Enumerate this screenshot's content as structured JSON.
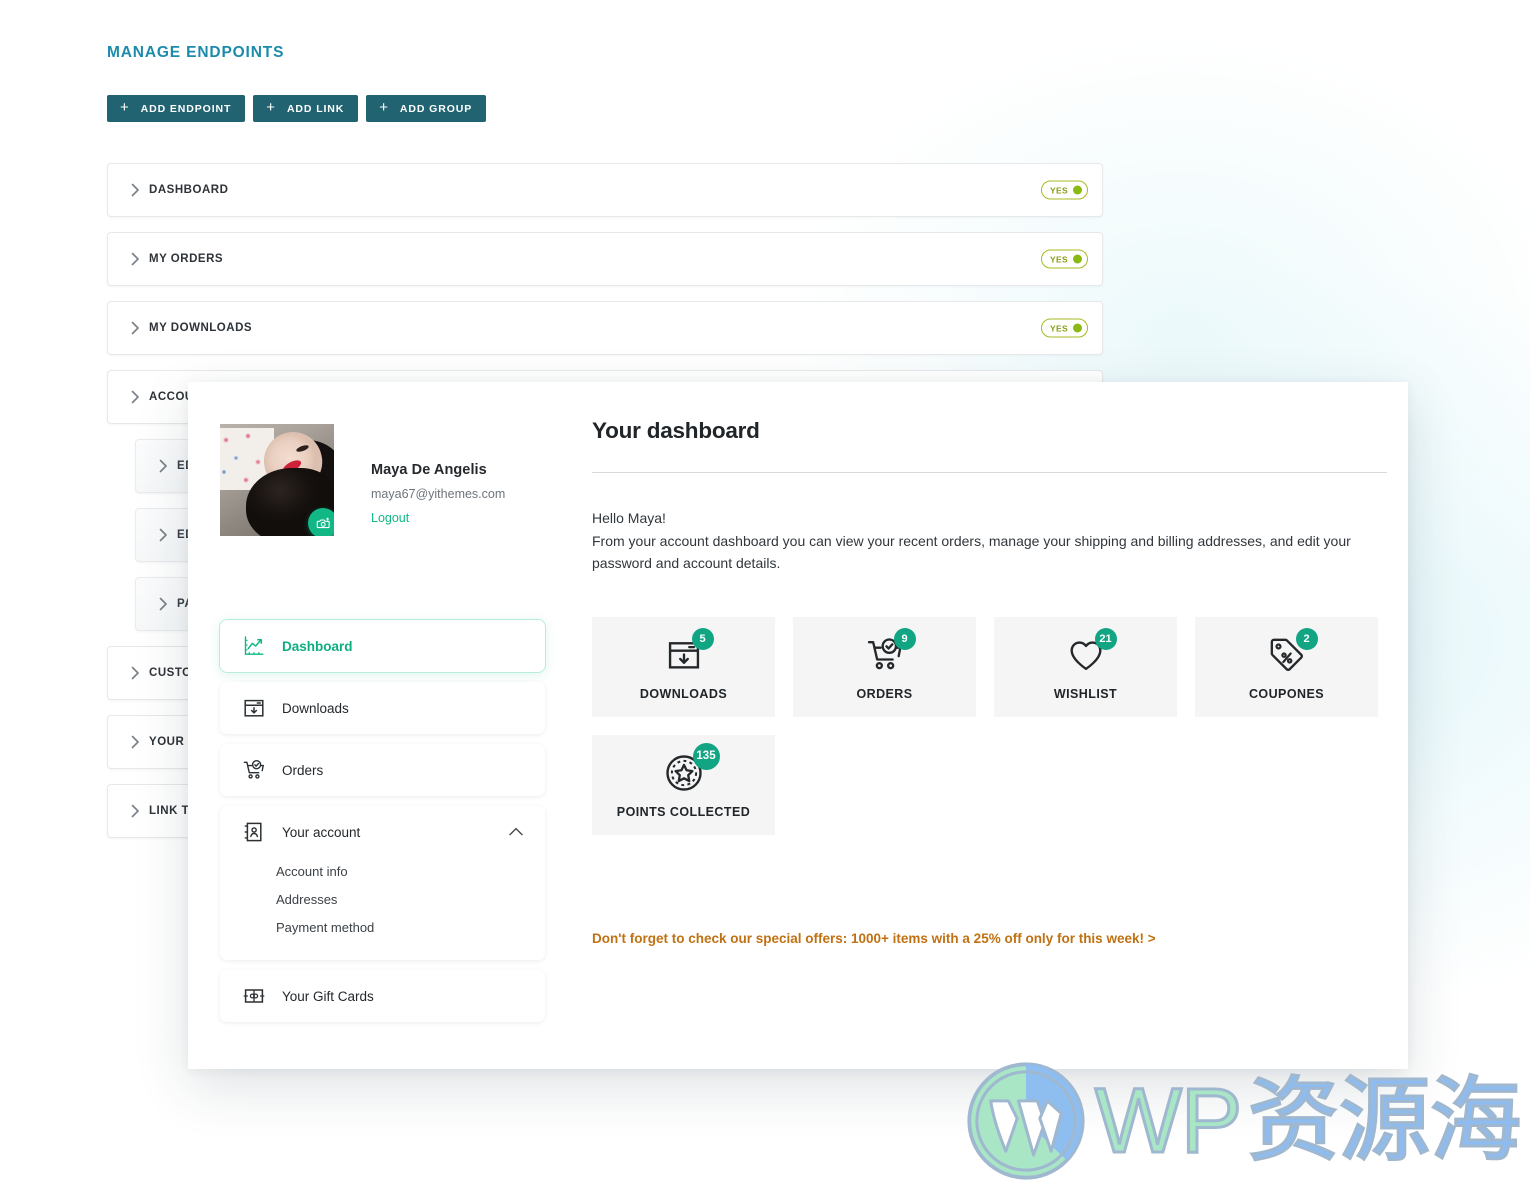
{
  "settings": {
    "title": "MANAGE ENDPOINTS",
    "buttons": [
      {
        "label": "ADD ENDPOINT",
        "icon": "plus-icon"
      },
      {
        "label": "ADD LINK",
        "icon": "plus-icon"
      },
      {
        "label": "ADD GROUP",
        "icon": "plus-icon"
      }
    ],
    "toggle_on_label": "YES",
    "rows": [
      {
        "label": "DASHBOARD",
        "toggle": "YES",
        "nested": false,
        "has_toggle": true
      },
      {
        "label": "MY ORDERS",
        "toggle": "YES",
        "nested": false,
        "has_toggle": true
      },
      {
        "label": "MY DOWNLOADS",
        "toggle": "YES",
        "nested": false,
        "has_toggle": true
      },
      {
        "label": "ACCOU",
        "nested": false,
        "has_toggle": false
      },
      {
        "label": "ED",
        "nested": true,
        "has_toggle": false
      },
      {
        "label": "ED",
        "nested": true,
        "has_toggle": false
      },
      {
        "label": "PA",
        "nested": true,
        "has_toggle": false
      },
      {
        "label": "CUSTO",
        "nested": false,
        "has_toggle": false
      },
      {
        "label": "YOUR C",
        "nested": false,
        "has_toggle": false
      },
      {
        "label": "LINK TO",
        "nested": false,
        "has_toggle": false
      }
    ]
  },
  "panel": {
    "user": {
      "name": "Maya De Angelis",
      "email": "maya67@yithemes.com",
      "logout_label": "Logout",
      "avatar_icon": "user-photo",
      "camera_icon": "camera-icon"
    },
    "nav": [
      {
        "label": "Dashboard",
        "icon": "line-chart-icon",
        "active": true
      },
      {
        "label": "Downloads",
        "icon": "download-box-icon",
        "active": false
      },
      {
        "label": "Orders",
        "icon": "cart-check-icon",
        "active": false
      }
    ],
    "nav_group": {
      "label": "Your account",
      "icon": "address-book-icon",
      "expanded": true,
      "caret_icon": "chevron-up-icon",
      "children": [
        {
          "label": "Account info"
        },
        {
          "label": "Addresses"
        },
        {
          "label": "Payment method"
        }
      ]
    },
    "nav_last": {
      "label": "Your Gift Cards",
      "icon": "gift-card-icon"
    },
    "main": {
      "title": "Your dashboard",
      "greeting": "Hello Maya!",
      "intro": "From your account dashboard you can view your recent orders, manage your shipping and billing addresses, and edit your password and account details.",
      "cards": [
        {
          "label": "DOWNLOADS",
          "count": "5",
          "icon": "download-box-icon"
        },
        {
          "label": "ORDERS",
          "count": "9",
          "icon": "cart-check-icon"
        },
        {
          "label": "WISHLIST",
          "count": "21",
          "icon": "heart-icon"
        },
        {
          "label": "COUPONES",
          "count": "2",
          "icon": "coupon-tag-icon"
        }
      ],
      "cards_row2": [
        {
          "label": "POINTS COLLECTED",
          "count": "135",
          "icon": "star-coin-icon"
        }
      ],
      "promo": "Don't forget to check our special offers: 1000+ items with a 25% off only for this week! >"
    }
  },
  "watermark": {
    "en": "WP",
    "cn": "资源海",
    "logo_icon": "wordpress-logo-icon"
  },
  "colors": {
    "accent_teal": "#226372",
    "heading_blue": "#1c8bab",
    "green": "#11b886",
    "badge_green": "#11a583",
    "toggle_olive": "#8aba12",
    "promo_orange": "#c07113"
  }
}
